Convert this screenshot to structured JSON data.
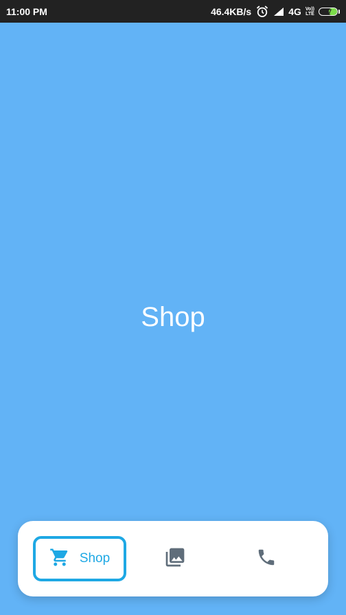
{
  "status_bar": {
    "time": "11:00 PM",
    "network_speed": "46.4KB/s",
    "alarm_icon": "alarm-icon",
    "signal_icon": "signal-icon",
    "network_type": "4G",
    "volte_top": "Vo))",
    "volte_bottom": "LTE",
    "battery_level": "47"
  },
  "main": {
    "title": "Shop"
  },
  "bottom_nav": {
    "items": [
      {
        "label": "Shop",
        "icon": "cart-icon",
        "active": true,
        "color": "#1ea8e4"
      },
      {
        "icon": "photo-library-icon",
        "active": false,
        "color": "#5f6d7a"
      },
      {
        "icon": "phone-icon",
        "active": false,
        "color": "#5f6d7a"
      }
    ]
  },
  "colors": {
    "background": "#62b3f6",
    "status_bar": "#222222",
    "accent": "#1ea8e4",
    "inactive_icon": "#5f6d7a"
  }
}
